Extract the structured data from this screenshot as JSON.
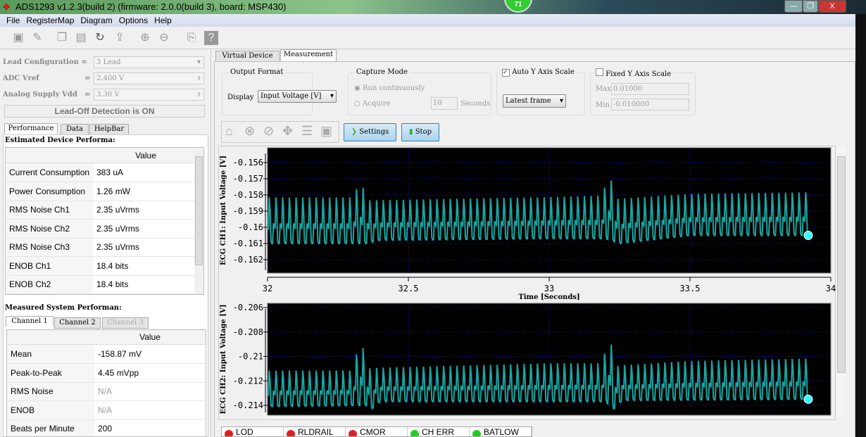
{
  "window": {
    "title": "ADS1293 v1.2.3(build 2) (firmware: 2.0.0(build 3), board: MSP430)",
    "badge": "71",
    "min": "—",
    "max": "❐",
    "close": "X"
  },
  "menu": [
    "File",
    "RegisterMap",
    "Diagram",
    "Options",
    "Help"
  ],
  "toolbar_icons": [
    "save-icon",
    "open-icon",
    "copy-icon",
    "paste-icon",
    "refresh-icon",
    "export-icon",
    "zoom-in-icon",
    "zoom-out-icon",
    "pdf-icon",
    "help-icon"
  ],
  "config": {
    "lead_label": "Lead Configuration =",
    "lead_value": "3 Lead",
    "vref_label": "ADC Vref",
    "vref_eq": "=",
    "vref_value": "2.400 V",
    "vdd_label": "Analog Supply Vdd",
    "vdd_eq": "=",
    "vdd_value": "3.30 V",
    "leadoff": "Lead-Off Detection is ON"
  },
  "left_tabs": [
    "Performance",
    "Data",
    "HelpBar"
  ],
  "estimated": {
    "title": "Estimated Device Performa:",
    "header": "Value",
    "rows": [
      {
        "k": "Current Consumption",
        "v": "383 uA"
      },
      {
        "k": "Power Consumption",
        "v": "1.26 mW"
      },
      {
        "k": "RMS Noise Ch1",
        "v": "2.35 uVrms"
      },
      {
        "k": "RMS Noise Ch2",
        "v": "2.35 uVrms"
      },
      {
        "k": "RMS Noise Ch3",
        "v": "2.35 uVrms"
      },
      {
        "k": "ENOB Ch1",
        "v": "18.4 bits"
      },
      {
        "k": "ENOB Ch2",
        "v": "18.4 bits"
      }
    ]
  },
  "measured": {
    "title": "Measured System Performan:",
    "tabs": [
      "Channel 1",
      "Channel 2",
      "Channel 3"
    ],
    "header": "Value",
    "rows": [
      {
        "k": "Mean",
        "v": "-158.87 mV"
      },
      {
        "k": "Peak-to-Peak",
        "v": "4.45 mVpp"
      },
      {
        "k": "RMS Noise",
        "v": "N/A"
      },
      {
        "k": "ENOB",
        "v": "N/A"
      },
      {
        "k": "Beats per Minute",
        "v": "200"
      }
    ]
  },
  "main_tabs": [
    "Virtual Device",
    "Measurement"
  ],
  "output_format": {
    "title": "Output Format",
    "display_label": "Display",
    "display_value": "Input Voltage [V]"
  },
  "capture": {
    "title": "Capture Mode",
    "run": "Run continuously",
    "acquire": "Acquire",
    "seconds_value": "10",
    "seconds_label": "Seconds"
  },
  "auto_y": {
    "label": "Auto Y Axis Scale",
    "checked": true,
    "mode": "Latest frame"
  },
  "fixed_y": {
    "label": "Fixed Y Axis Scale",
    "checked": false,
    "max_label": "Max",
    "max_value": "0.01000",
    "min_label": "Min",
    "min_value": "-0.010000"
  },
  "plot_buttons": {
    "settings": "Settings",
    "stop": "Stop"
  },
  "indicators": [
    {
      "label": "LOD",
      "color": "#e02020"
    },
    {
      "label": "RLDRAIL",
      "color": "#e02020"
    },
    {
      "label": "CMOR",
      "color": "#e02020"
    },
    {
      "label": "CH ERR",
      "color": "#20d020"
    },
    {
      "label": "BATLOW",
      "color": "#20d020"
    }
  ],
  "chart_data": [
    {
      "type": "line",
      "ylabel": "ECG CH1: Input Voltage [V]",
      "xlabel": "Time [Seconds]",
      "xlim": [
        32,
        34
      ],
      "ylim": [
        -0.1627,
        -0.1552
      ],
      "xticks": [
        "32",
        "32.5",
        "33",
        "33.5",
        "34"
      ],
      "yticks": [
        "-0.156",
        "-0.157",
        "-0.158",
        "-0.159",
        "-0.16",
        "-0.161",
        "-0.162"
      ],
      "grid": true,
      "color": "#1aa6a0",
      "oscillation_hz": 42,
      "upper": [
        [
          32,
          -0.158
        ],
        [
          32.3,
          -0.158
        ],
        [
          32.33,
          -0.157
        ],
        [
          32.36,
          -0.1582
        ],
        [
          33.0,
          -0.158
        ],
        [
          33.19,
          -0.1579
        ],
        [
          33.21,
          -0.1563
        ],
        [
          33.24,
          -0.1581
        ],
        [
          33.5,
          -0.1578
        ],
        [
          33.92,
          -0.1577
        ]
      ],
      "lower": [
        [
          32,
          -0.161
        ],
        [
          32.35,
          -0.161
        ],
        [
          32.4,
          -0.1608
        ],
        [
          33.0,
          -0.1607
        ],
        [
          33.2,
          -0.1607
        ],
        [
          33.25,
          -0.161
        ],
        [
          33.5,
          -0.1605
        ],
        [
          33.92,
          -0.1605
        ]
      ],
      "last_point": [
        33.92,
        -0.1605
      ]
    },
    {
      "type": "line",
      "ylabel": "ECG CH2: Input Voltage [V]",
      "xlim": [
        32,
        34
      ],
      "ylim": [
        -0.2061,
        -0.2151
      ],
      "yticks": [
        "-0.206",
        "-0.208",
        "-0.21",
        "-0.212",
        "-0.214"
      ],
      "grid": true,
      "color": "#1aa6a0",
      "oscillation_hz": 42,
      "upper": [
        [
          32,
          -0.211
        ],
        [
          32.3,
          -0.211
        ],
        [
          32.33,
          -0.2083
        ],
        [
          32.36,
          -0.2108
        ],
        [
          33.0,
          -0.2104
        ],
        [
          33.19,
          -0.2104
        ],
        [
          33.21,
          -0.2078
        ],
        [
          33.24,
          -0.2106
        ],
        [
          33.5,
          -0.2102
        ],
        [
          33.92,
          -0.21
        ]
      ],
      "lower": [
        [
          32,
          -0.2141
        ],
        [
          32.35,
          -0.214
        ],
        [
          32.37,
          -0.2143
        ],
        [
          32.4,
          -0.2137
        ],
        [
          33.0,
          -0.2137
        ],
        [
          33.2,
          -0.2137
        ],
        [
          33.23,
          -0.2143
        ],
        [
          33.26,
          -0.2136
        ],
        [
          33.92,
          -0.2135
        ]
      ],
      "last_point": [
        33.92,
        -0.2135
      ]
    }
  ]
}
